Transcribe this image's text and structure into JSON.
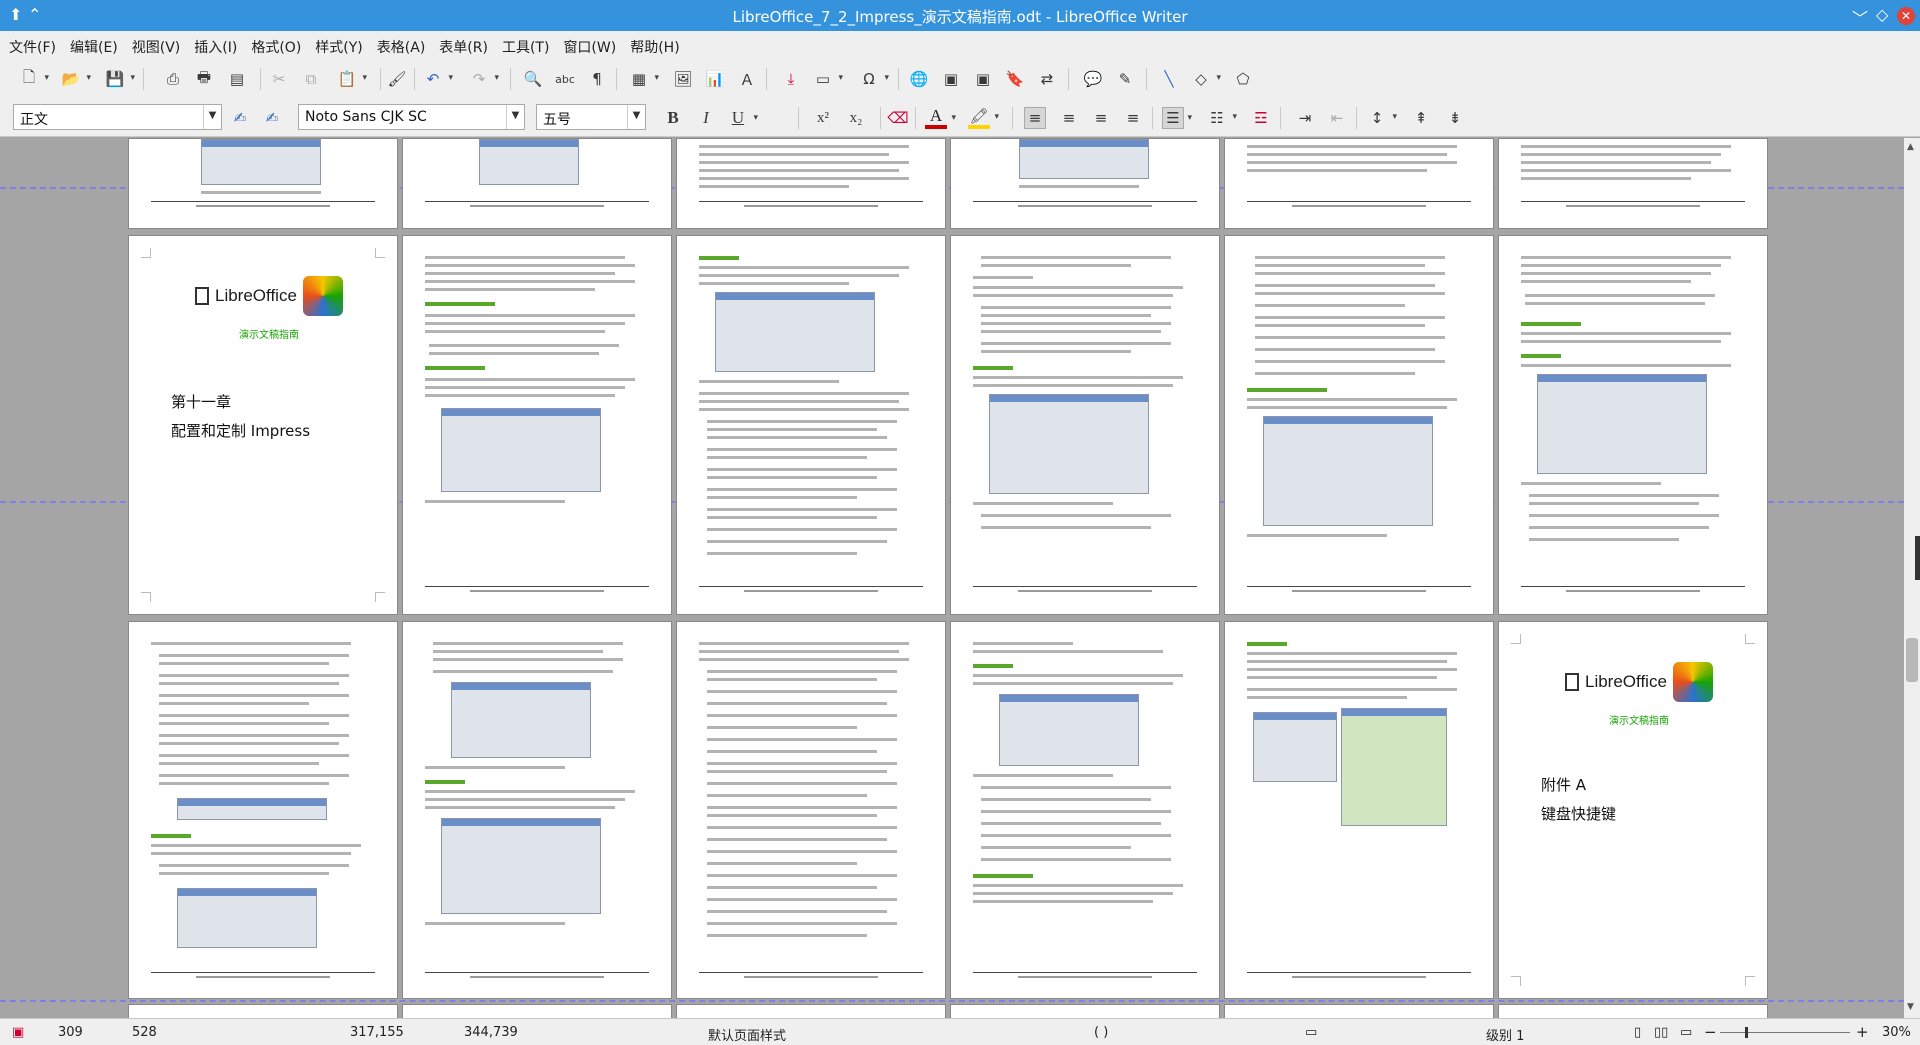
{
  "titlebar": {
    "title": "LibreOffice_7_2_Impress_演示文稿指南.odt - LibreOffice Writer"
  },
  "menu": [
    "文件(F)",
    "编辑(E)",
    "视图(V)",
    "插入(I)",
    "格式(O)",
    "样式(Y)",
    "表格(A)",
    "表单(R)",
    "工具(T)",
    "窗口(W)",
    "帮助(H)"
  ],
  "formatting": {
    "paragraph_style": "正文",
    "font_name": "Noto Sans CJK SC",
    "font_size": "五号"
  },
  "toolbar_letters": {
    "bold": "B",
    "italic": "I",
    "underline": "U",
    "superscript": "x²",
    "subscript": "x₂",
    "font_color": "A"
  },
  "pages": {
    "chapter_logo": "LibreOffice",
    "chapter_subtitle": "演示文稿指南",
    "chapter_number": "第十一章",
    "chapter_title": "配置和定制 Impress",
    "appendix_logo": "LibreOffice",
    "appendix_subtitle": "演示文稿指南",
    "appendix_number": "附件 A",
    "appendix_title": "键盘快捷键"
  },
  "statusbar": {
    "page_number": "309",
    "page_count": "528",
    "words": "317,155",
    "characters": "344,739",
    "page_style": "默认页面样式",
    "language": "(      )",
    "outline_level": "级别 1",
    "zoom": "30%"
  },
  "colors": {
    "titlebar": "#3593dd",
    "accent_green": "#18a303",
    "font_color_red": "#cc0000",
    "highlight_yellow": "#ffd400"
  }
}
